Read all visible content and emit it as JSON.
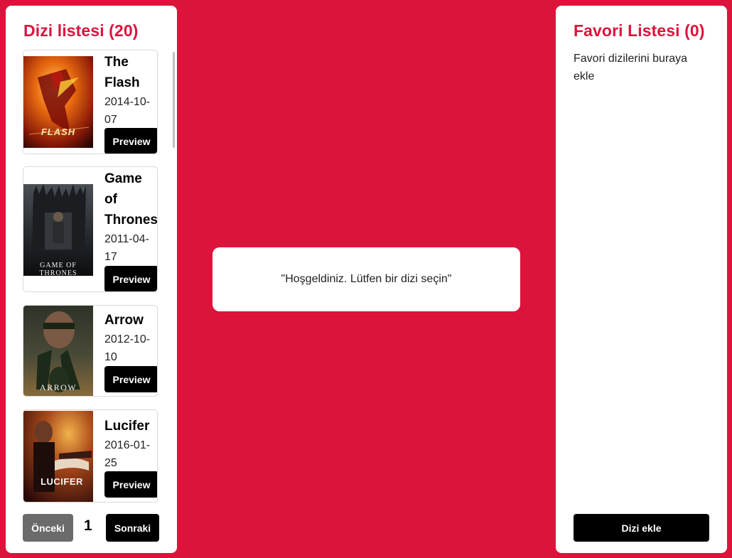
{
  "series_panel": {
    "title": "Dizi listesi (20)",
    "items": [
      {
        "name": "The Flash",
        "date": "2014-10-07",
        "preview_label": "Preview",
        "poster_caption": "FLASH",
        "poster_icon": "flash-poster"
      },
      {
        "name": "Game of Thrones",
        "date": "2011-04-17",
        "preview_label": "Preview",
        "poster_caption": "GAME OF THRONES",
        "poster_icon": "game-of-thrones-poster"
      },
      {
        "name": "Arrow",
        "date": "2012-10-10",
        "preview_label": "Preview",
        "poster_caption": "ARROW",
        "poster_icon": "arrow-poster"
      },
      {
        "name": "Lucifer",
        "date": "2016-01-25",
        "preview_label": "Preview",
        "poster_caption": "LUCIFER",
        "poster_icon": "lucifer-poster"
      }
    ],
    "pagination": {
      "prev_label": "Önceki",
      "page": "1",
      "next_label": "Sonraki"
    }
  },
  "welcome": {
    "message": "\"Hoşgeldiniz. Lütfen bir dizi seçin\""
  },
  "favorites_panel": {
    "title": "Favori Listesi (0)",
    "hint": "Favori dizilerini buraya ekle",
    "add_label": "Dizi ekle"
  },
  "colors": {
    "background": "#dc143c",
    "accent": "#dc143c",
    "button": "#000000",
    "disabled_button": "#6b6b6b"
  }
}
